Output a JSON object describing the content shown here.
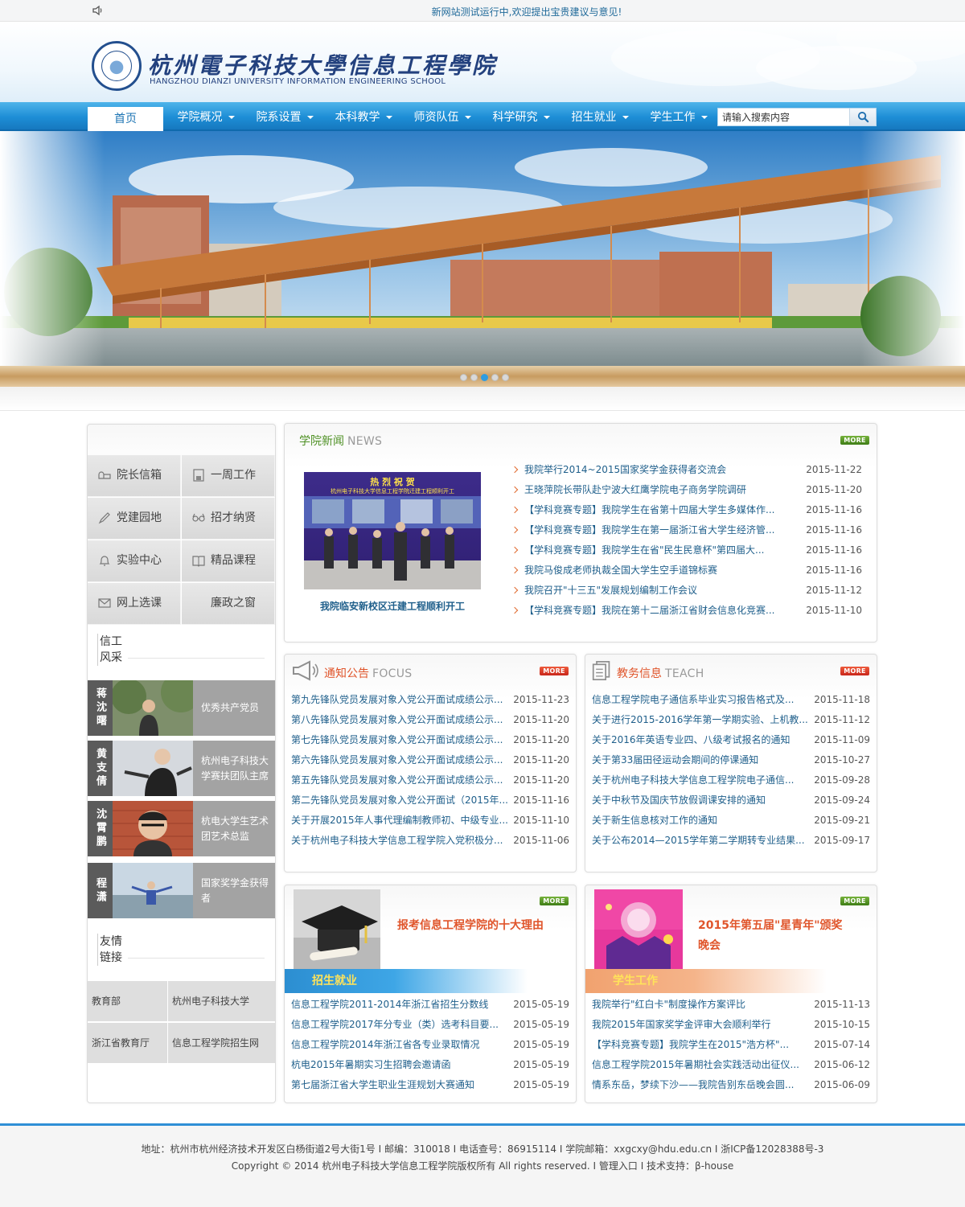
{
  "topbar": {
    "notice": "新网站测试运行中,欢迎提出宝贵建议与意见!",
    "speaker_icon": "speaker-icon"
  },
  "header": {
    "title": "杭州電子科技大學信息工程學院",
    "subtitle": "HANGZHOU DIANZI UNIVERSITY INFORMATION ENGINEERING SCHOOL"
  },
  "nav": {
    "items": [
      {
        "label": "首页",
        "dropdown": false
      },
      {
        "label": "学院概况",
        "dropdown": true
      },
      {
        "label": "院系设置",
        "dropdown": true
      },
      {
        "label": "本科教学",
        "dropdown": true
      },
      {
        "label": "师资队伍",
        "dropdown": true
      },
      {
        "label": "科学研究",
        "dropdown": true
      },
      {
        "label": "招生就业",
        "dropdown": true
      },
      {
        "label": "学生工作",
        "dropdown": true
      }
    ],
    "search_value": "请输入搜索内容"
  },
  "banner": {
    "slide_count": 5,
    "active_slide": 3
  },
  "sidebar": {
    "quick_links": [
      {
        "label": "院长信箱",
        "icon": "mailbox-icon"
      },
      {
        "label": "一周工作",
        "icon": "save-icon"
      },
      {
        "label": "党建园地",
        "icon": "pen-icon"
      },
      {
        "label": "招才纳贤",
        "icon": "glasses-icon"
      },
      {
        "label": "实验中心",
        "icon": "bell-icon"
      },
      {
        "label": "精品课程",
        "icon": "book-icon"
      },
      {
        "label": "网上选课",
        "icon": "envelope-icon"
      },
      {
        "label": "廉政之窗",
        "icon": "moon-icon"
      }
    ],
    "style_title": "信工风采",
    "style_title_lines": [
      "信工",
      "风采"
    ],
    "people": [
      {
        "name": "蒋沈曙",
        "desc": "优秀共产党员"
      },
      {
        "name": "黄支倩",
        "desc": "杭州电子科技大学赛扶团队主席"
      },
      {
        "name": "沈霄鹏",
        "desc": "杭电大学生艺术团艺术总监"
      },
      {
        "name": "程潇",
        "desc": "国家奖学金获得者"
      }
    ],
    "links_title_lines": [
      "友情",
      "链接"
    ],
    "links": [
      "教育部",
      "杭州电子科技大学",
      "浙江省教育厅",
      "信息工程学院招生网"
    ]
  },
  "news": {
    "title": "学院新闻",
    "title_en": "NEWS",
    "more": "MORE",
    "feature_caption": "我院临安新校区迁建工程顺利开工",
    "feature_banner_line1": "热 烈 祝 贺",
    "feature_banner_line2": "杭州电子科技大学信息工程学院迁建工程顺利开工",
    "items": [
      {
        "title": "我院举行2014~2015国家奖学金获得者交流会",
        "date": "2015-11-22"
      },
      {
        "title": "王晓萍院长带队赴宁波大红鹰学院电子商务学院调研",
        "date": "2015-11-20"
      },
      {
        "title": "【学科竞赛专题】我院学生在省第十四届大学生多媒体作...",
        "date": "2015-11-16"
      },
      {
        "title": "【学科竞赛专题】我院学生在第一届浙江省大学生经济管...",
        "date": "2015-11-16"
      },
      {
        "title": "【学科竞赛专题】我院学生在省\"民生民意杯\"第四届大...",
        "date": "2015-11-16"
      },
      {
        "title": "我院马俊成老师执裁全国大学生空手道锦标赛",
        "date": "2015-11-16"
      },
      {
        "title": "我院召开\"十三五\"发展规划编制工作会议",
        "date": "2015-11-12"
      },
      {
        "title": "【学科竞赛专题】我院在第十二届浙江省财会信息化竞赛...",
        "date": "2015-11-10"
      }
    ]
  },
  "notice": {
    "title": "通知公告",
    "title_en": "FOCUS",
    "more": "MORE",
    "items": [
      {
        "title": "第九先锋队党员发展对象入党公开面试成绩公示...",
        "date": "2015-11-23"
      },
      {
        "title": "第八先锋队党员发展对象入党公开面试成绩公示...",
        "date": "2015-11-20"
      },
      {
        "title": "第七先锋队党员发展对象入党公开面试成绩公示...",
        "date": "2015-11-20"
      },
      {
        "title": "第六先锋队党员发展对象入党公开面试成绩公示...",
        "date": "2015-11-20"
      },
      {
        "title": "第五先锋队党员发展对象入党公开面试成绩公示...",
        "date": "2015-11-20"
      },
      {
        "title": "第二先锋队党员发展对象入党公开面试（2015年...",
        "date": "2015-11-16"
      },
      {
        "title": "关于开展2015年人事代理编制教师初、中级专业...",
        "date": "2015-11-10"
      },
      {
        "title": "关于杭州电子科技大学信息工程学院入党积极分...",
        "date": "2015-11-06"
      }
    ]
  },
  "teach": {
    "title": "教务信息",
    "title_en": "TEACH",
    "more": "MORE",
    "items": [
      {
        "title": "信息工程学院电子通信系毕业实习报告格式及...",
        "date": "2015-11-18"
      },
      {
        "title": "关于进行2015-2016学年第一学期实验、上机教...",
        "date": "2015-11-12"
      },
      {
        "title": "关于2016年英语专业四、八级考试报名的通知",
        "date": "2015-11-09"
      },
      {
        "title": "关于第33届田径运动会期间的停课通知",
        "date": "2015-10-27"
      },
      {
        "title": "关于杭州电子科技大学信息工程学院电子通信...",
        "date": "2015-09-28"
      },
      {
        "title": "关于中秋节及国庆节放假调课安排的通知",
        "date": "2015-09-24"
      },
      {
        "title": "关于新生信息核对工作的通知",
        "date": "2015-09-21"
      },
      {
        "title": "关于公布2014—2015学年第二学期转专业结果...",
        "date": "2015-09-17"
      }
    ]
  },
  "admission": {
    "title": "招生就业",
    "more": "MORE",
    "feature_text": "报考信息工程学院的十大理由",
    "items": [
      {
        "title": "信息工程学院2011-2014年浙江省招生分数线",
        "date": "2015-05-19"
      },
      {
        "title": "信息工程学院2017年分专业（类）选考科目要...",
        "date": "2015-05-19"
      },
      {
        "title": "信息工程学院2014年浙江省各专业录取情况",
        "date": "2015-05-19"
      },
      {
        "title": "杭电2015年暑期实习生招聘会邀请函",
        "date": "2015-05-19"
      },
      {
        "title": "第七届浙江省大学生职业生涯规划大赛通知",
        "date": "2015-05-19"
      }
    ]
  },
  "student": {
    "title": "学生工作",
    "more": "MORE",
    "feature_text": "2015年第五届\"星青年\"颁奖晚会",
    "items": [
      {
        "title": "我院举行\"红白卡\"制度操作方案评比",
        "date": "2015-11-13"
      },
      {
        "title": "我院2015年国家奖学金评审大会顺利举行",
        "date": "2015-10-15"
      },
      {
        "title": "【学科竞赛专题】我院学生在2015\"浩方杯\"...",
        "date": "2015-07-14"
      },
      {
        "title": "信息工程学院2015年暑期社会实践活动出征仪...",
        "date": "2015-06-12"
      },
      {
        "title": "情系东岳，梦续下沙——我院告别东岳晚会圆...",
        "date": "2015-06-09"
      }
    ]
  },
  "footer": {
    "line1": "地址：杭州市杭州经济技术开发区白杨街道2号大街1号  I  邮编：310018  I  电话查号：86915114  I  学院邮箱：xxgcxy@hdu.edu.cn  I  浙ICP备12028388号-3",
    "copyright": "Copyright © 2014  杭州电子科技大学信息工程学院版权所有     All rights reserved.  I ",
    "admin_link": "管理入口",
    "support": "  I  技术支持：β-house"
  },
  "colors": {
    "nav_blue": "#1d8ed6",
    "accent_orange": "#e0552b",
    "link_teal": "#1f5f8b",
    "more_green": "#4f9125"
  }
}
